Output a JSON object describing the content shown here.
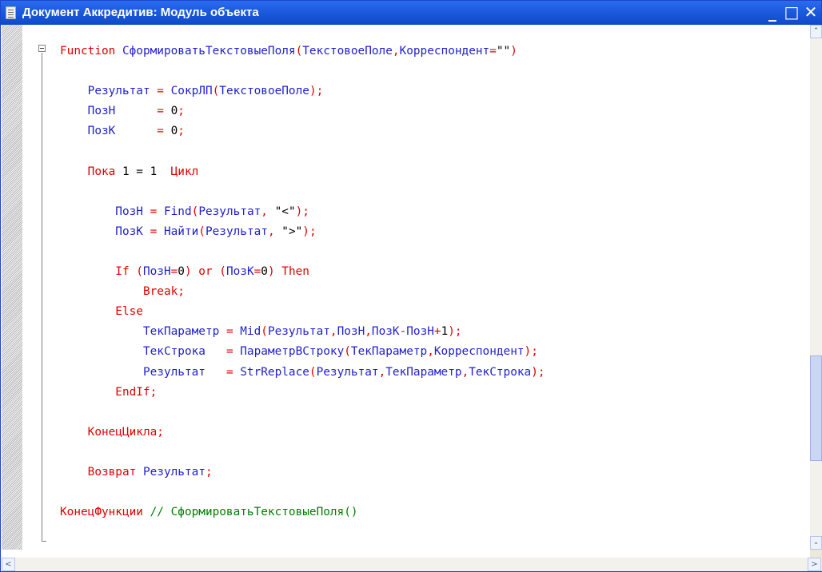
{
  "window": {
    "title": "Документ Аккредитив: Модуль объекта",
    "icon": "document-icon",
    "controls": {
      "minimize": "_",
      "maximize": "□",
      "close": "✕"
    }
  },
  "colors": {
    "titlebar": "#1d5ce0",
    "keyword": "#e00000",
    "identifier": "#1f1fcf",
    "comment": "#008000",
    "number": "#000000"
  },
  "code_lines": [
    [
      [
        "kw",
        "Function"
      ],
      [
        "id",
        " СформироватьТекстовыеПоля"
      ],
      [
        "op",
        "("
      ],
      [
        "id",
        "ТекстовоеПоле"
      ],
      [
        "op",
        ","
      ],
      [
        "id",
        "Корреспондент"
      ],
      [
        "op",
        "="
      ],
      [
        "str",
        "\"\""
      ],
      [
        "op",
        ")"
      ]
    ],
    [],
    [
      [
        "id",
        "    Результат "
      ],
      [
        "op",
        "="
      ],
      [
        "id",
        " СокрЛП"
      ],
      [
        "op",
        "("
      ],
      [
        "id",
        "ТекстовоеПоле"
      ],
      [
        "op",
        ");"
      ]
    ],
    [
      [
        "id",
        "    ПозН      "
      ],
      [
        "op",
        "="
      ],
      [
        "num",
        " 0"
      ],
      [
        "op",
        ";"
      ]
    ],
    [
      [
        "id",
        "    ПозК      "
      ],
      [
        "op",
        "="
      ],
      [
        "num",
        " 0"
      ],
      [
        "op",
        ";"
      ]
    ],
    [],
    [
      [
        "kw",
        "    Пока"
      ],
      [
        "num",
        " 1 = 1 "
      ],
      [
        "kw",
        " Цикл"
      ]
    ],
    [],
    [
      [
        "id",
        "        ПозН "
      ],
      [
        "op",
        "="
      ],
      [
        "id",
        " Find"
      ],
      [
        "op",
        "("
      ],
      [
        "id",
        "Результат"
      ],
      [
        "op",
        ","
      ],
      [
        "str",
        " \"<\""
      ],
      [
        "op",
        ");"
      ]
    ],
    [
      [
        "id",
        "        ПозК "
      ],
      [
        "op",
        "="
      ],
      [
        "id",
        " Найти"
      ],
      [
        "op",
        "("
      ],
      [
        "id",
        "Результат"
      ],
      [
        "op",
        ","
      ],
      [
        "str",
        " \">\""
      ],
      [
        "op",
        ");"
      ]
    ],
    [],
    [
      [
        "kw",
        "        If"
      ],
      [
        "op",
        " ("
      ],
      [
        "id",
        "ПозН"
      ],
      [
        "op",
        "="
      ],
      [
        "num",
        "0"
      ],
      [
        "op",
        ")"
      ],
      [
        "kw",
        " or"
      ],
      [
        "op",
        " ("
      ],
      [
        "id",
        "ПозК"
      ],
      [
        "op",
        "="
      ],
      [
        "num",
        "0"
      ],
      [
        "op",
        ")"
      ],
      [
        "kw",
        " Then"
      ]
    ],
    [
      [
        "kw",
        "            Break"
      ],
      [
        "op",
        ";"
      ]
    ],
    [
      [
        "kw",
        "        Else"
      ]
    ],
    [
      [
        "id",
        "            ТекПараметр "
      ],
      [
        "op",
        "="
      ],
      [
        "id",
        " Mid"
      ],
      [
        "op",
        "("
      ],
      [
        "id",
        "Результат"
      ],
      [
        "op",
        ","
      ],
      [
        "id",
        "ПозН"
      ],
      [
        "op",
        ","
      ],
      [
        "id",
        "ПозК"
      ],
      [
        "op",
        "-"
      ],
      [
        "id",
        "ПозН"
      ],
      [
        "op",
        "+"
      ],
      [
        "num",
        "1"
      ],
      [
        "op",
        ");"
      ]
    ],
    [
      [
        "id",
        "            ТекСтрока   "
      ],
      [
        "op",
        "="
      ],
      [
        "id",
        " ПараметрВСтроку"
      ],
      [
        "op",
        "("
      ],
      [
        "id",
        "ТекПараметр"
      ],
      [
        "op",
        ","
      ],
      [
        "id",
        "Корреспондент"
      ],
      [
        "op",
        ");"
      ]
    ],
    [
      [
        "id",
        "            Результат   "
      ],
      [
        "op",
        "="
      ],
      [
        "id",
        " StrReplace"
      ],
      [
        "op",
        "("
      ],
      [
        "id",
        "Результат"
      ],
      [
        "op",
        ","
      ],
      [
        "id",
        "ТекПараметр"
      ],
      [
        "op",
        ","
      ],
      [
        "id",
        "ТекСтрока"
      ],
      [
        "op",
        ");"
      ]
    ],
    [
      [
        "kw",
        "        EndIf"
      ],
      [
        "op",
        ";"
      ]
    ],
    [],
    [
      [
        "kw",
        "    КонецЦикла"
      ],
      [
        "op",
        ";"
      ]
    ],
    [],
    [
      [
        "kw",
        "    Возврат"
      ],
      [
        "id",
        " Результат"
      ],
      [
        "op",
        ";"
      ]
    ],
    [],
    [
      [
        "kw",
        "КонецФункции"
      ],
      [
        "cm",
        " // СформироватьТекстовыеПоля()"
      ]
    ]
  ],
  "scrollbars": {
    "up": "⌃",
    "down": "⌄",
    "left": "<",
    "right": ">"
  }
}
